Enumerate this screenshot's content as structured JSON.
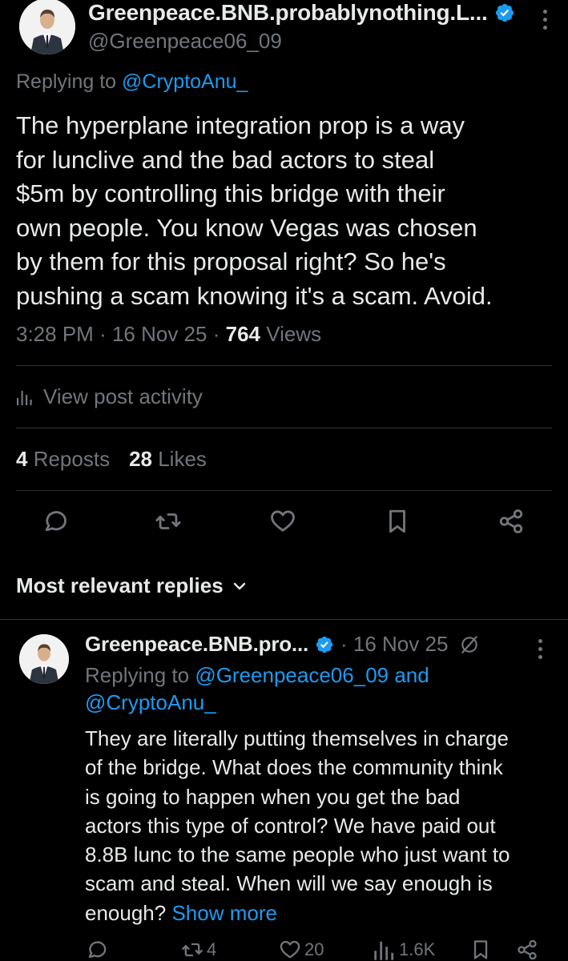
{
  "post": {
    "display_name": "Greenpeace.BNB.probablynothing.L...",
    "handle": "@Greenpeace06_09",
    "replying_prefix": "Replying to ",
    "replying_to": "@CryptoAnu_",
    "body_lines": [
      "The hyperplane integration prop is a way",
      "for lunclive and the bad actors to steal",
      "$5m by controlling this bridge with their",
      "own people.  You know Vegas was chosen",
      "by them for this proposal right? So he's",
      "pushing a scam knowing it's a scam.  Avoid."
    ],
    "time": "3:28 PM",
    "date": "16 Nov 25",
    "views_count": "764",
    "views_label": " Views",
    "view_activity_label": "View post activity",
    "reposts_count": "4",
    "reposts_label": " Reposts",
    "likes_count": "28",
    "likes_label": " Likes",
    "actions": [
      "reply-icon",
      "repost-icon",
      "like-icon",
      "bookmark-icon",
      "share-icon"
    ]
  },
  "replies_header": {
    "label": "Most relevant replies"
  },
  "reply": {
    "display_name": "Greenpeace.BNB.pro...",
    "date": "· 16 Nov 25",
    "replying_prefix": "Replying to ",
    "replying_to_1": "@Greenpeace06_09",
    "replying_and": " and",
    "replying_to_2": "@CryptoAnu_",
    "body_lines": [
      "They are literally putting themselves in charge",
      "of the bridge.  What does the community think",
      "is going to happen when you get the bad",
      "actors this type of control?  We have paid out",
      "8.8B lunc to the same people who just want to",
      "scam and steal.  When will we say enough is"
    ],
    "last_line": "enough? ",
    "show_more": "Show more",
    "repost_count": "4",
    "like_count": "20",
    "views_count": "1.6K"
  },
  "colors": {
    "background": "#000000",
    "text": "#e7e9ea",
    "muted": "#71767b",
    "accent": "#1d9bf0",
    "divider": "#2f3336"
  }
}
